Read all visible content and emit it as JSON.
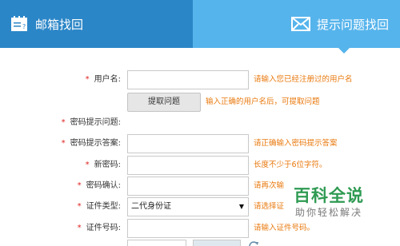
{
  "tabs": {
    "email_label": "邮箱找回",
    "question_label": "提示问题找回",
    "email_icon": "notepad-icon",
    "question_icon": "envelope-icon"
  },
  "form": {
    "username": {
      "label": "用户名:",
      "hint": "请输入您已经注册过的用户名"
    },
    "fetch": {
      "button": "提取问题",
      "hint": "输入正确的用户名后，可提取问题"
    },
    "question": {
      "label": "密码提示问题:"
    },
    "answer": {
      "label": "密码提示答案:",
      "hint": "请正确输入密码提示答案"
    },
    "new_password": {
      "label": "新密码:",
      "hint": "长度不少于6位字符。"
    },
    "confirm_password": {
      "label": "密码确认:",
      "hint": "请再次输"
    },
    "id_type": {
      "label": "证件类型:",
      "selected": "二代身份证",
      "hint": "请选择证"
    },
    "id_number": {
      "label": "证件号码:",
      "hint": "请输入证件号码。"
    },
    "required_mark": "*"
  },
  "watermark": {
    "main": "百科全说",
    "sub": "助你轻松解决"
  },
  "colors": {
    "tab_active": "#2b86c7",
    "tab_inactive": "#56b4ec",
    "hint": "#e9780c",
    "required": "#e02020",
    "watermark": "#2e9a52"
  }
}
